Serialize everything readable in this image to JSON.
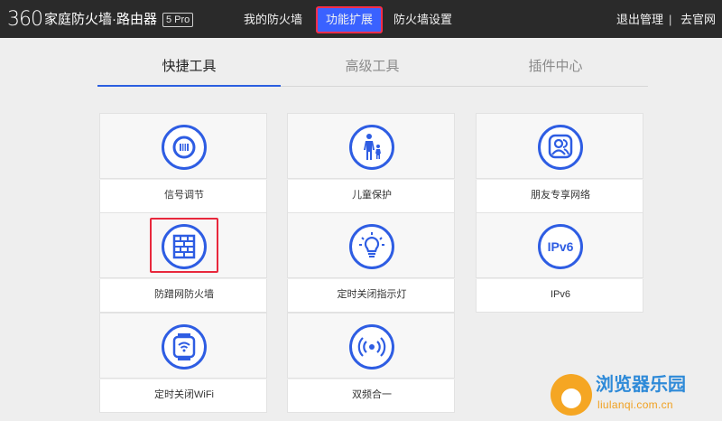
{
  "header": {
    "logo_num": "360",
    "logo_text": "家庭防火墙·路由器",
    "logo_badge": "5 Pro",
    "nav": [
      {
        "label": "我的防火墙"
      },
      {
        "label": "功能扩展"
      },
      {
        "label": "防火墙设置"
      }
    ],
    "logout": "退出管理",
    "separator": "|",
    "official": "去官网"
  },
  "tabs": [
    {
      "label": "快捷工具"
    },
    {
      "label": "高级工具"
    },
    {
      "label": "插件中心"
    }
  ],
  "cards": [
    {
      "label": "信号调节",
      "icon": "signal-adjust-icon"
    },
    {
      "label": "儿童保护",
      "icon": "child-protection-icon"
    },
    {
      "label": "朋友专享网络",
      "icon": "friends-network-icon"
    },
    {
      "label": "防蹭网防火墙",
      "icon": "anti-leech-firewall-icon"
    },
    {
      "label": "定时关闭指示灯",
      "icon": "timed-light-off-icon"
    },
    {
      "label": "IPv6",
      "icon": "ipv6-icon"
    },
    {
      "label": "定时关闭WiFi",
      "icon": "timed-wifi-off-icon"
    },
    {
      "label": "双频合一",
      "icon": "dual-band-icon"
    }
  ],
  "ipv6_icon_text": "IPv6",
  "watermark": {
    "title": "浏览器乐园",
    "url": "liulanqi.com.cn"
  },
  "colors": {
    "topbar": "#2a2a2a",
    "accent": "#2e5de3",
    "highlight": "#e8283c"
  }
}
